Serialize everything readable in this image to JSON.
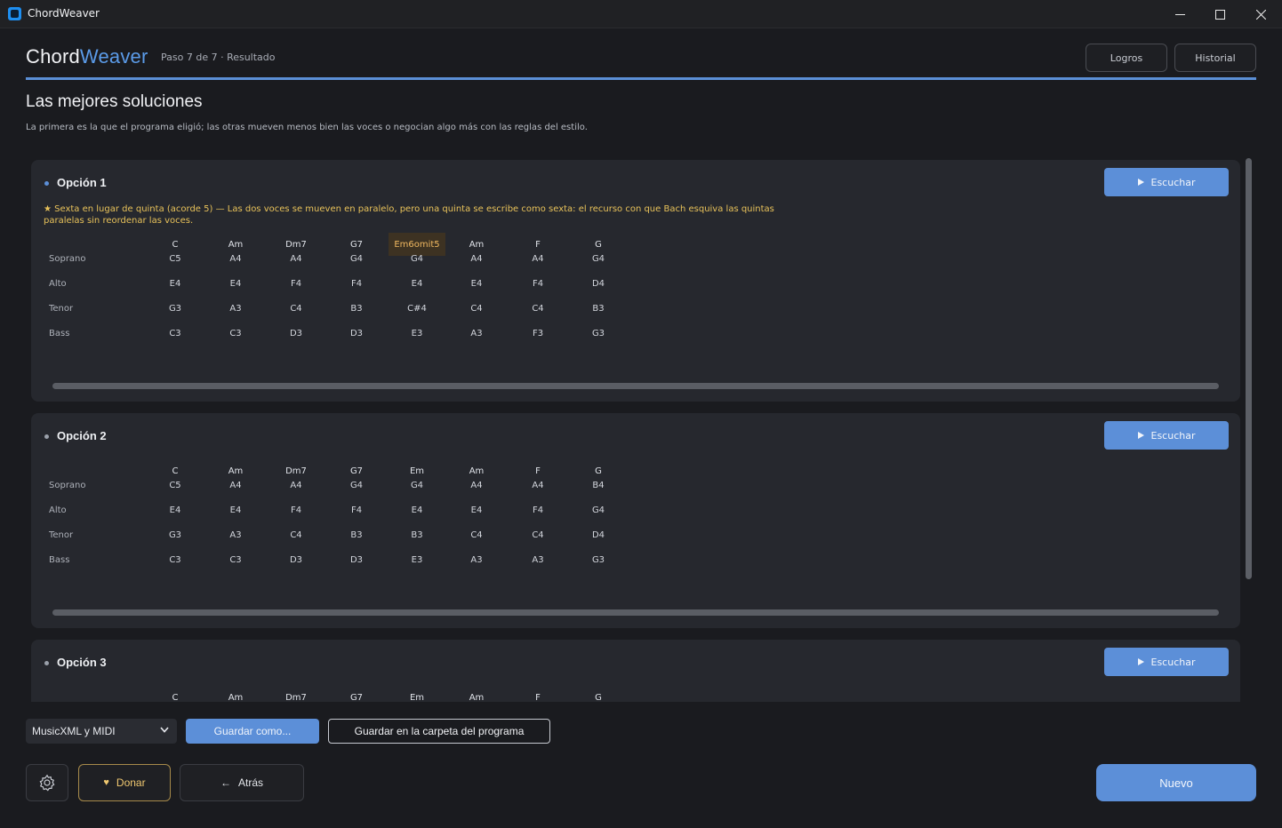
{
  "window": {
    "title": "ChordWeaver"
  },
  "header": {
    "brand_first": "Chord",
    "brand_second": "Weaver",
    "step": "Paso 7 de 7 · Resultado",
    "achievements_label": "Logros",
    "history_label": "Historial"
  },
  "page": {
    "title": "Las mejores soluciones",
    "subtitle": "La primera es la que el programa eligió; las otras mueven menos bien las voces o negocian algo más con las reglas del estilo."
  },
  "voices": [
    "Soprano",
    "Alto",
    "Tenor",
    "Bass"
  ],
  "options": [
    {
      "title": "Opción 1",
      "listen_label": "Escuchar",
      "note": "★  Sexta en lugar de quinta  (acorde 5) — Las dos voces se mueven en paralelo, pero una quinta se escribe como sexta: el recurso con que Bach esquiva las quintas paralelas sin reordenar las voces.",
      "chords": [
        "C",
        "Am",
        "Dm7",
        "G7",
        "Em6omit5",
        "Am",
        "F",
        "G"
      ],
      "highlight_index": 4,
      "rows": [
        [
          "C5",
          "A4",
          "A4",
          "G4",
          "G4",
          "A4",
          "A4",
          "G4"
        ],
        [
          "E4",
          "E4",
          "F4",
          "F4",
          "E4",
          "E4",
          "F4",
          "D4"
        ],
        [
          "G3",
          "A3",
          "C4",
          "B3",
          "C#4",
          "C4",
          "C4",
          "B3"
        ],
        [
          "C3",
          "C3",
          "D3",
          "D3",
          "E3",
          "A3",
          "F3",
          "G3"
        ]
      ]
    },
    {
      "title": "Opción 2",
      "listen_label": "Escuchar",
      "chords": [
        "C",
        "Am",
        "Dm7",
        "G7",
        "Em",
        "Am",
        "F",
        "G"
      ],
      "rows": [
        [
          "C5",
          "A4",
          "A4",
          "G4",
          "G4",
          "A4",
          "A4",
          "B4"
        ],
        [
          "E4",
          "E4",
          "F4",
          "F4",
          "E4",
          "E4",
          "F4",
          "G4"
        ],
        [
          "G3",
          "A3",
          "C4",
          "B3",
          "B3",
          "C4",
          "C4",
          "D4"
        ],
        [
          "C3",
          "C3",
          "D3",
          "D3",
          "E3",
          "A3",
          "A3",
          "G3"
        ]
      ]
    },
    {
      "title": "Opción 3",
      "listen_label": "Escuchar",
      "chords": [
        "C",
        "Am",
        "Dm7",
        "G7",
        "Em",
        "Am",
        "F",
        "G"
      ]
    }
  ],
  "export": {
    "format_selected": "MusicXML y MIDI",
    "save_as_label": "Guardar como...",
    "save_program_folder_label": "Guardar en la carpeta del programa"
  },
  "footer": {
    "donate_label": "Donar",
    "back_label": "Atrás",
    "new_label": "Nuevo"
  },
  "colors": {
    "accent": "#5c8fd8",
    "note_gold": "#e8c25a",
    "highlight_bg": "#3d3222",
    "option1_bullet": "#5c8fd8",
    "option_bullet": "#9aa0aa"
  },
  "icons": {
    "app": "chordweaver-app-icon",
    "settings": "gear-icon",
    "donate": "heart-icon",
    "back": "arrow-left-icon",
    "listen": "play-icon",
    "select": "chevron-down-icon"
  }
}
